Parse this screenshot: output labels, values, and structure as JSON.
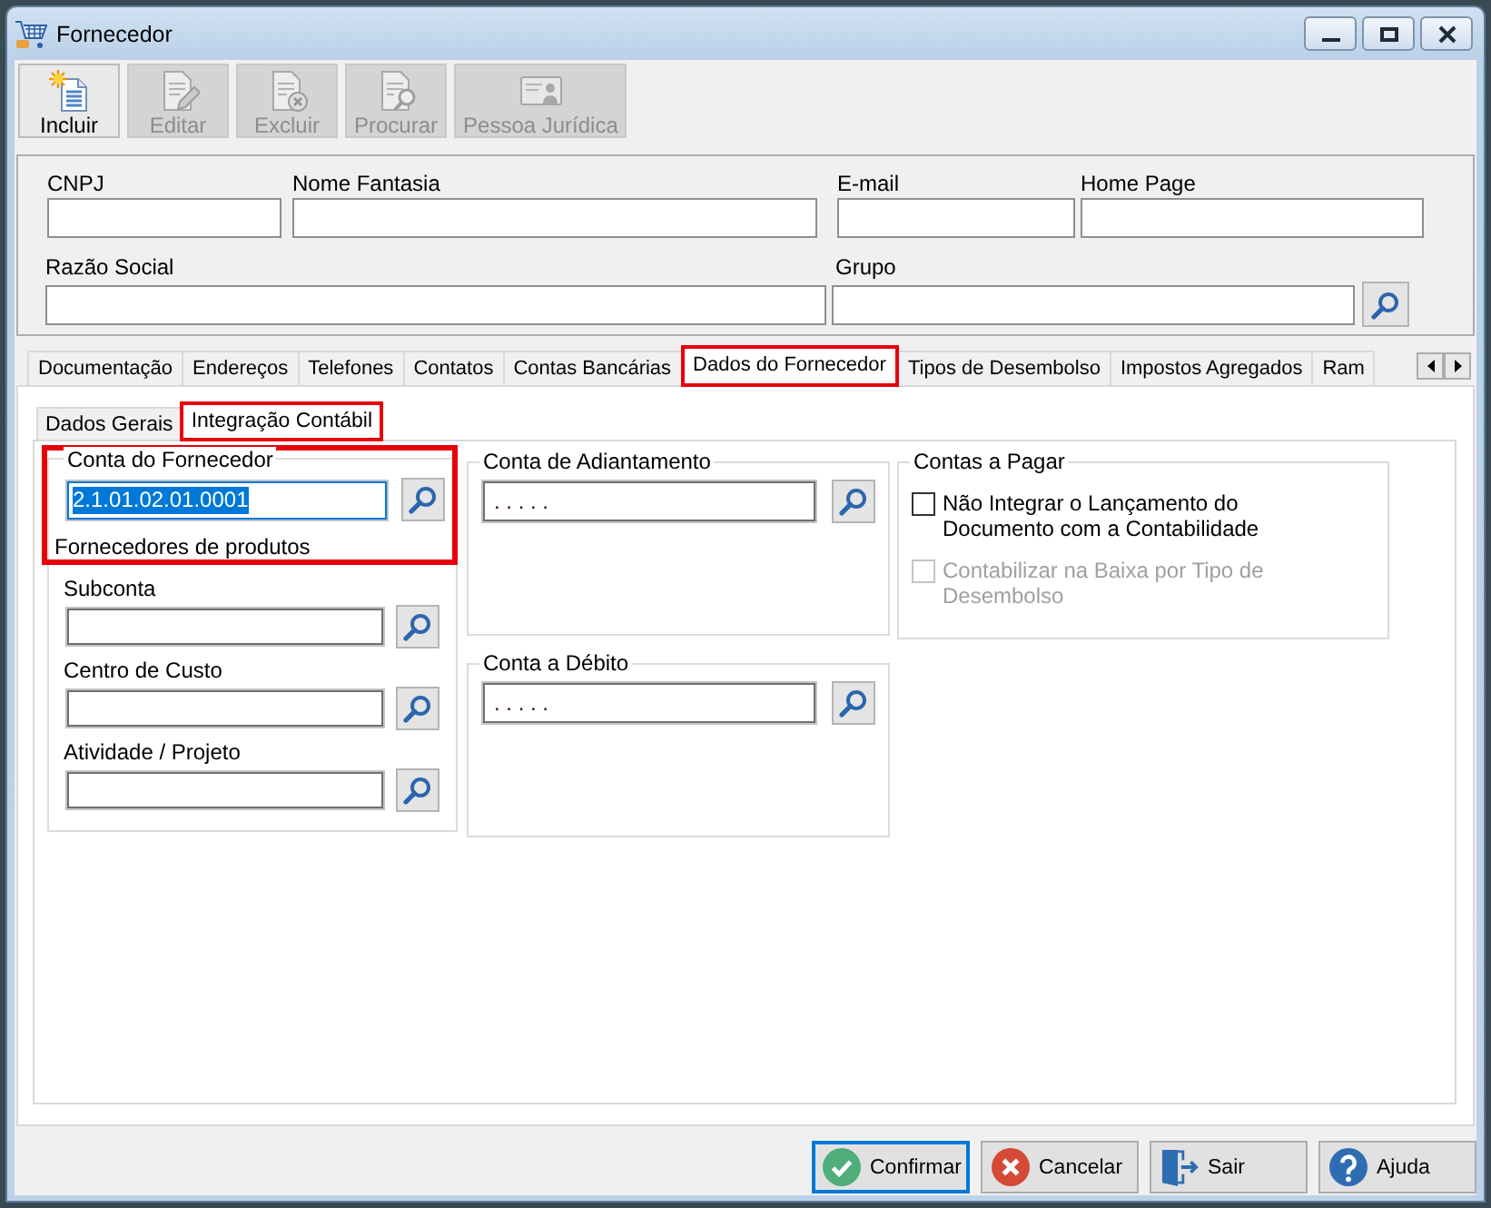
{
  "window": {
    "title": "Fornecedor"
  },
  "toolbar": [
    {
      "kind": "new",
      "label": "Incluir",
      "disabled": false
    },
    {
      "kind": "edit",
      "label": "Editar",
      "disabled": true
    },
    {
      "kind": "delete",
      "label": "Excluir",
      "disabled": true
    },
    {
      "kind": "search",
      "label": "Procurar",
      "disabled": true
    },
    {
      "kind": "card",
      "label": "Pessoa Jurídica",
      "disabled": true
    }
  ],
  "header_fields": [
    [
      {
        "label": "CNPJ",
        "lookup": false
      },
      {
        "label": "Nome Fantasia",
        "lookup": false
      },
      {
        "label": "E-mail",
        "lookup": false
      },
      {
        "label": "Home Page",
        "lookup": false
      }
    ],
    [
      {
        "label": "Razão Social",
        "lookup": false
      },
      {
        "label": "Grupo",
        "lookup": true
      }
    ]
  ],
  "tabs": [
    {
      "label": "Documentação",
      "selected": false,
      "highlighted": false
    },
    {
      "label": "Endereços",
      "selected": false,
      "highlighted": false
    },
    {
      "label": "Telefones",
      "selected": false,
      "highlighted": false
    },
    {
      "label": "Contatos",
      "selected": false,
      "highlighted": false
    },
    {
      "label": "Contas Bancárias",
      "selected": false,
      "highlighted": false
    },
    {
      "label": "Dados do Fornecedor",
      "selected": true,
      "highlighted": true
    },
    {
      "label": "Tipos de Desembolso",
      "selected": false,
      "highlighted": false
    },
    {
      "label": "Impostos Agregados",
      "selected": false,
      "highlighted": false
    },
    {
      "label": "Ram",
      "selected": false,
      "highlighted": false
    }
  ],
  "subtabs": [
    {
      "label": "Dados Gerais",
      "selected": false,
      "highlighted": false
    },
    {
      "label": "Integração Contábil",
      "selected": true,
      "highlighted": true
    }
  ],
  "supplier_account": {
    "title": "Conta do Fornecedor",
    "highlighted": true,
    "value": "2.1.01.02.01.0001",
    "focused": true,
    "text_selected": true,
    "description": "Fornecedores de produtos",
    "fields": [
      {
        "label": "Subconta"
      },
      {
        "label": "Centro de Custo"
      },
      {
        "label": "Atividade / Projeto"
      }
    ]
  },
  "account_groups": [
    {
      "title": "Conta de Adiantamento",
      "value": ". . . . ."
    },
    {
      "title": "Conta a Débito",
      "value": ". . . . ."
    }
  ],
  "payables": {
    "title": "Contas a Pagar",
    "options": [
      {
        "label": "Não Integrar o Lançamento do Documento com a Contabilidade",
        "checked": false,
        "disabled": false
      },
      {
        "label": "Contabilizar na Baixa por Tipo de Desembolso",
        "checked": false,
        "disabled": true
      }
    ]
  },
  "buttons": [
    {
      "kind": "confirm",
      "label": "Confirmar",
      "default": true
    },
    {
      "kind": "cancel",
      "label": "Cancelar",
      "default": false
    },
    {
      "kind": "exit",
      "label": "Sair",
      "default": false
    },
    {
      "kind": "help",
      "label": "Ajuda",
      "default": false
    }
  ]
}
